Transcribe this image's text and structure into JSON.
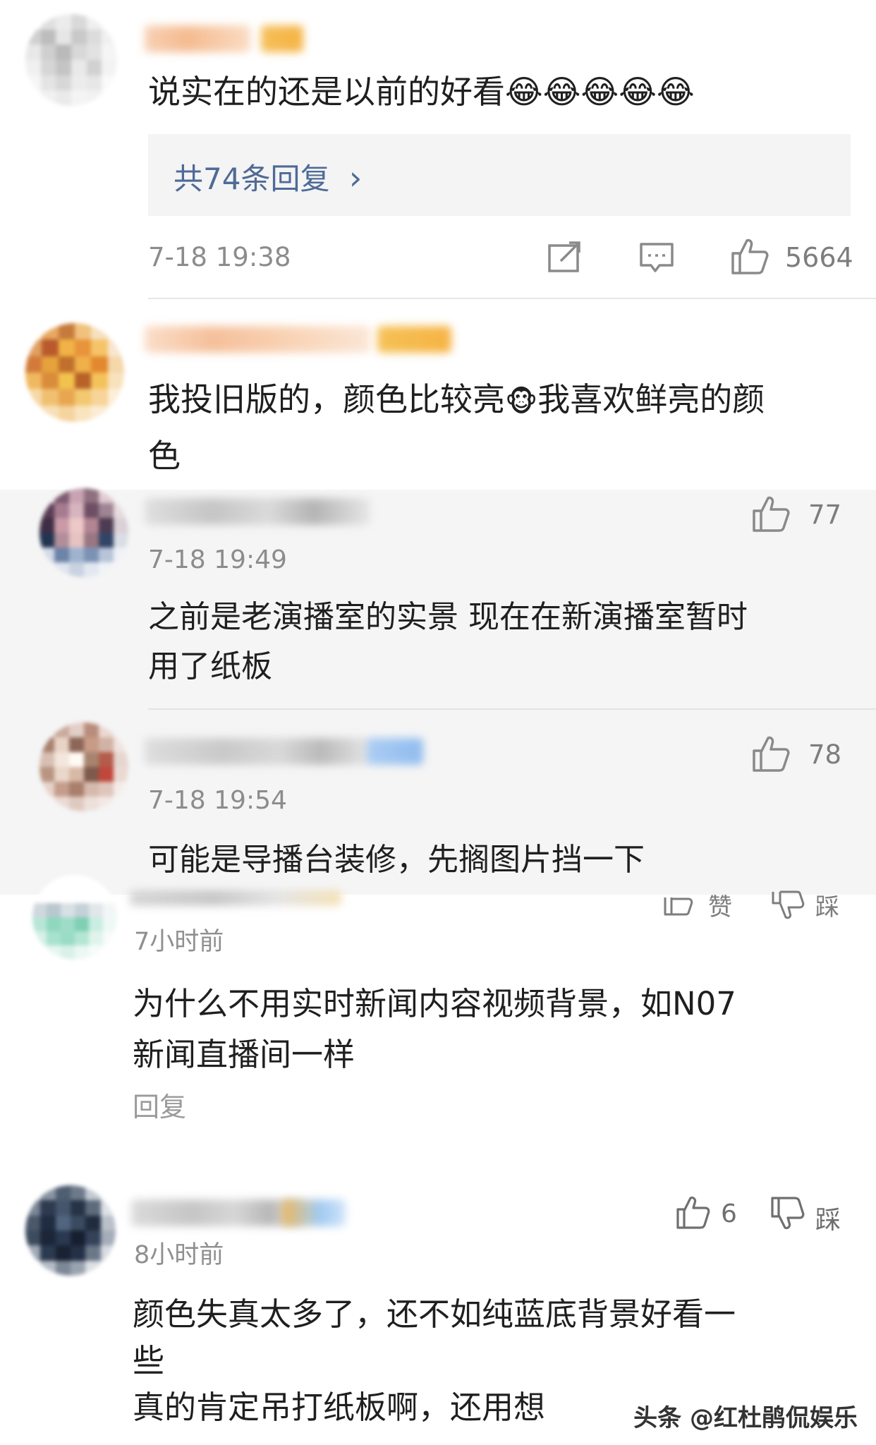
{
  "comments": [
    {
      "text": "说实在的还是以前的好看😂😂😂😂😂",
      "replies_label": "共74条回复",
      "reply_chevron": "›",
      "time": "7-18 19:38",
      "likes": "5664"
    },
    {
      "text": "我投旧版的，颜色比较亮🐵我喜欢鲜亮的颜色",
      "text_line1": "我投旧版的，颜色比较亮",
      "text_emoji": "🐵",
      "text_line1b": "我喜欢鲜亮的颜",
      "text_line2": "色"
    }
  ],
  "nested_replies": [
    {
      "time": "7-18 19:49",
      "likes": "77",
      "text_line1": "之前是老演播室的实景 现在在新演播室暂时",
      "text_line2": "用了纸板"
    },
    {
      "time": "7-18 19:54",
      "likes": "78",
      "text_line1": "可能是导播台装修，先搁图片挡一下"
    }
  ],
  "lower_comments": [
    {
      "time": "7小时前",
      "like_label": "赞",
      "dislike_label": "踩",
      "text_line1": "为什么不用实时新闻内容视频背景，如N07",
      "text_line2": "新闻直播间一样",
      "reply_label": "回复"
    },
    {
      "time": "8小时前",
      "likes": "6",
      "dislike_label": "踩",
      "text_line1": "颜色失真太多了，还不如纯蓝底背景好看一",
      "text_line2": "些",
      "text_line3": "真的肯定吊打纸板啊，还用想"
    }
  ],
  "watermark": "头条 @红杜鹃侃娱乐",
  "colors": {
    "panel_bg": "#f5f5f5",
    "link": "#4e6a97",
    "meta_text": "#8c8c8c",
    "body_text": "#1f1f1f"
  }
}
